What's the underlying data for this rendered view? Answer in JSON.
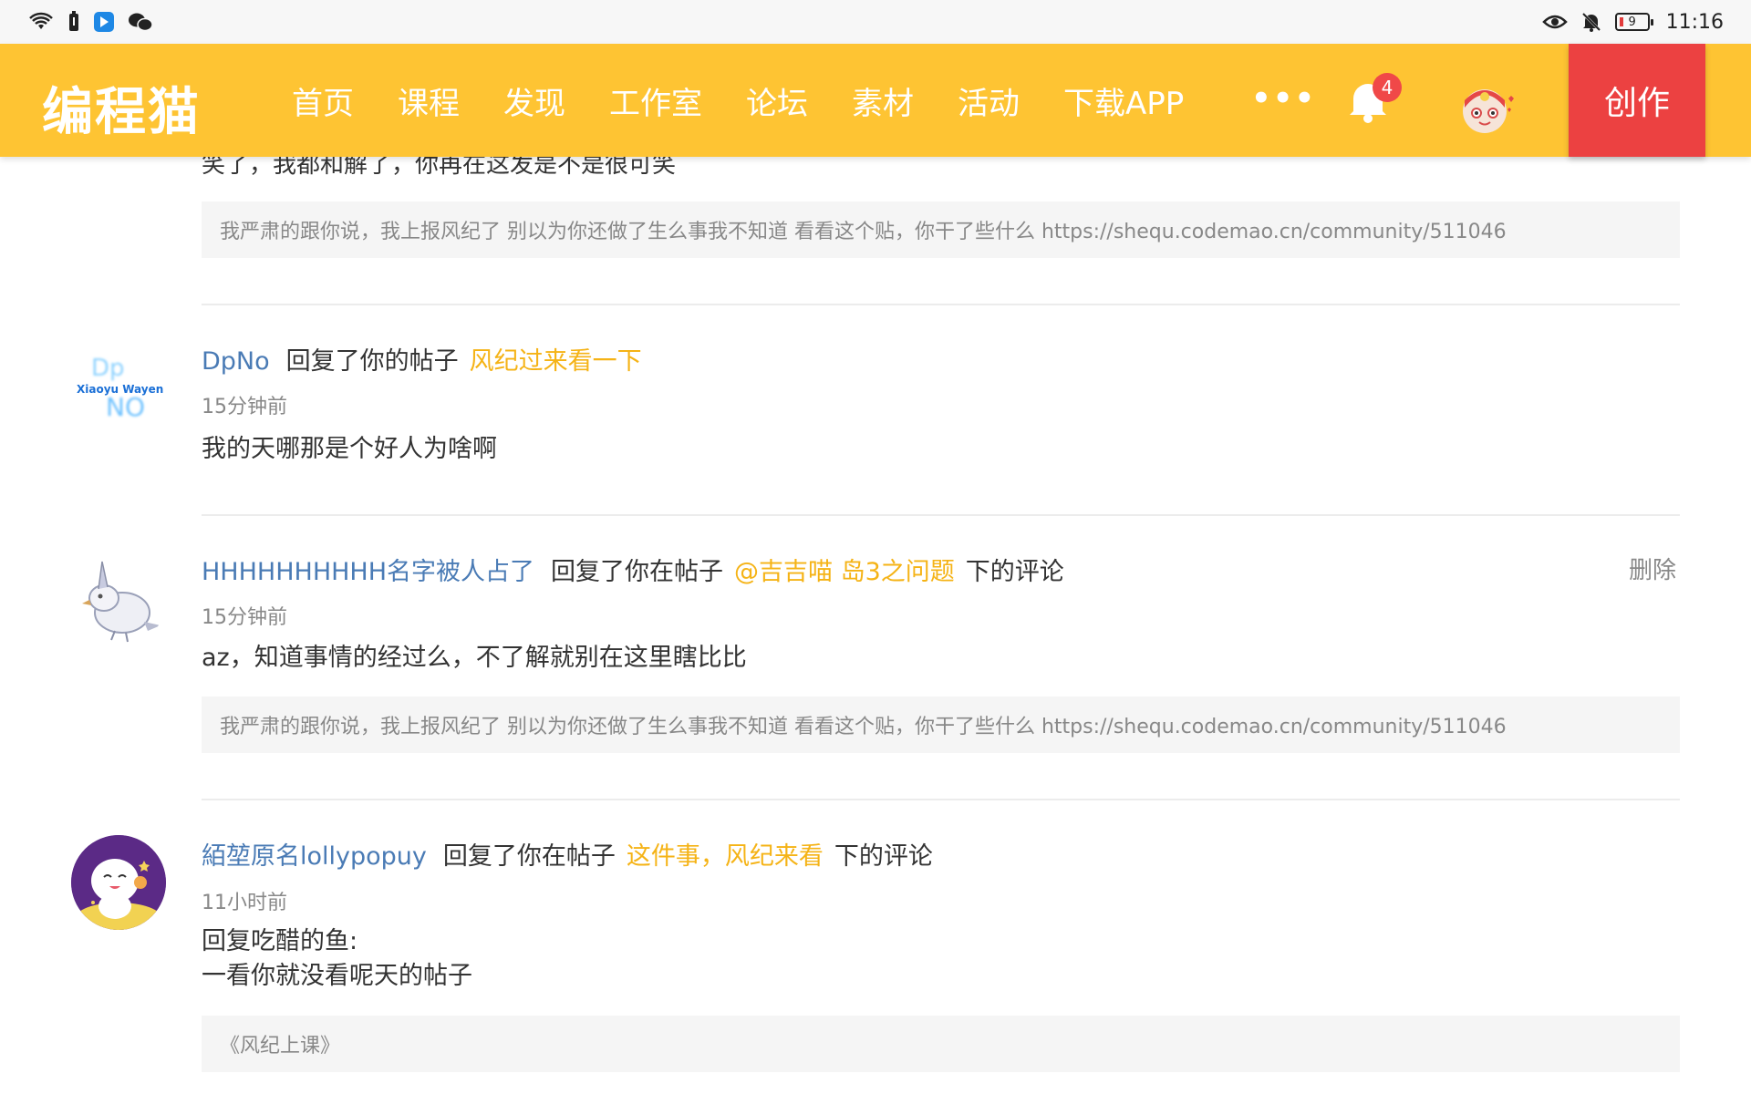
{
  "status_bar": {
    "time": "11:16",
    "battery": "9",
    "left_icons": [
      "wifi-icon",
      "battery-saver-icon",
      "app-icon",
      "wechat-icon"
    ],
    "right_icons": [
      "eye-icon",
      "mute-icon"
    ]
  },
  "nav": {
    "logo": "编程猫",
    "items": [
      "首页",
      "课程",
      "发现",
      "工作室",
      "论坛",
      "素材",
      "活动",
      "下载APP"
    ],
    "more": "•••",
    "notification_count": "4",
    "create_label": "创作",
    "colors": {
      "bar": "#fec433",
      "create": "#ec4141",
      "badge": "#f04848"
    }
  },
  "top_partial": {
    "text": "笑了，我都和解了，你再在这发是不是很可笑",
    "quote": "我严肃的跟你说，我上报风纪了 别以为你还做了生么事我不知道 看看这个贴，你干了些什么 https://shequ.codemao.cn/community/511046"
  },
  "notifications": [
    {
      "user": "DpNo",
      "action": "回复了你的帖子",
      "post": "风纪过来看一下",
      "suffix": "",
      "time": "15分钟前",
      "body": [
        "我的天哪那是个好人为啥啊"
      ],
      "avatar_text": {
        "top": "Dp",
        "middle": "Xiaoyu Wayen",
        "bottom": "NO"
      }
    },
    {
      "user": "HHHHHHHHHH名字被人占了",
      "action": "回复了你在帖子",
      "post": "@吉吉喵 岛3之问题",
      "suffix": "下的评论",
      "time": "15分钟前",
      "body": [
        "az，知道事情的经过么，不了解就别在这里瞎比比"
      ],
      "quote": "我严肃的跟你说，我上报风纪了 别以为你还做了生么事我不知道 看看这个贴，你干了些什么 https://shequ.codemao.cn/community/511046",
      "delete_label": "删除"
    },
    {
      "user": "絔堃原名lollypopuy",
      "action": "回复了你在帖子",
      "post": "这件事，风纪来看",
      "suffix": "下的评论",
      "time": "11小时前",
      "body": [
        "回复吃醋的鱼:",
        "一看你就没看呢天的帖子"
      ],
      "quote": "《风纪上课》"
    }
  ]
}
